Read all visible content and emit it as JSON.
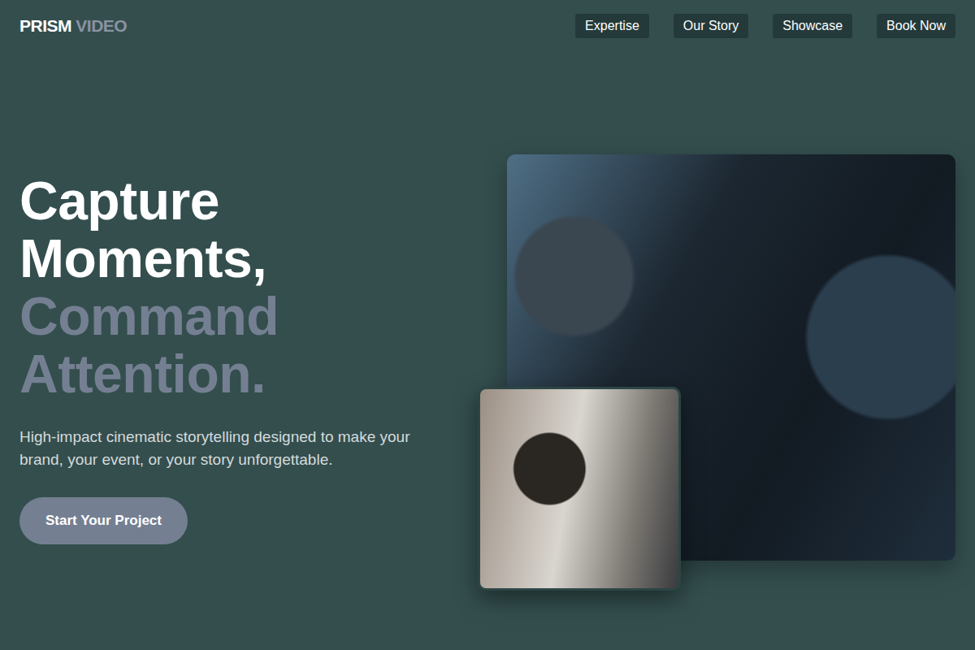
{
  "logo": {
    "primary": "PRISM",
    "secondary": "VIDEO"
  },
  "nav": [
    {
      "label": "Expertise"
    },
    {
      "label": "Our Story"
    },
    {
      "label": "Showcase"
    },
    {
      "label": "Book Now"
    }
  ],
  "hero": {
    "headline_primary": [
      "Capture",
      "Moments,"
    ],
    "headline_accent": [
      "Command",
      "Attention."
    ],
    "subtitle": "High-impact cinematic storytelling designed to make your brand, your event, or your story unforgettable.",
    "cta": "Start Your Project"
  }
}
